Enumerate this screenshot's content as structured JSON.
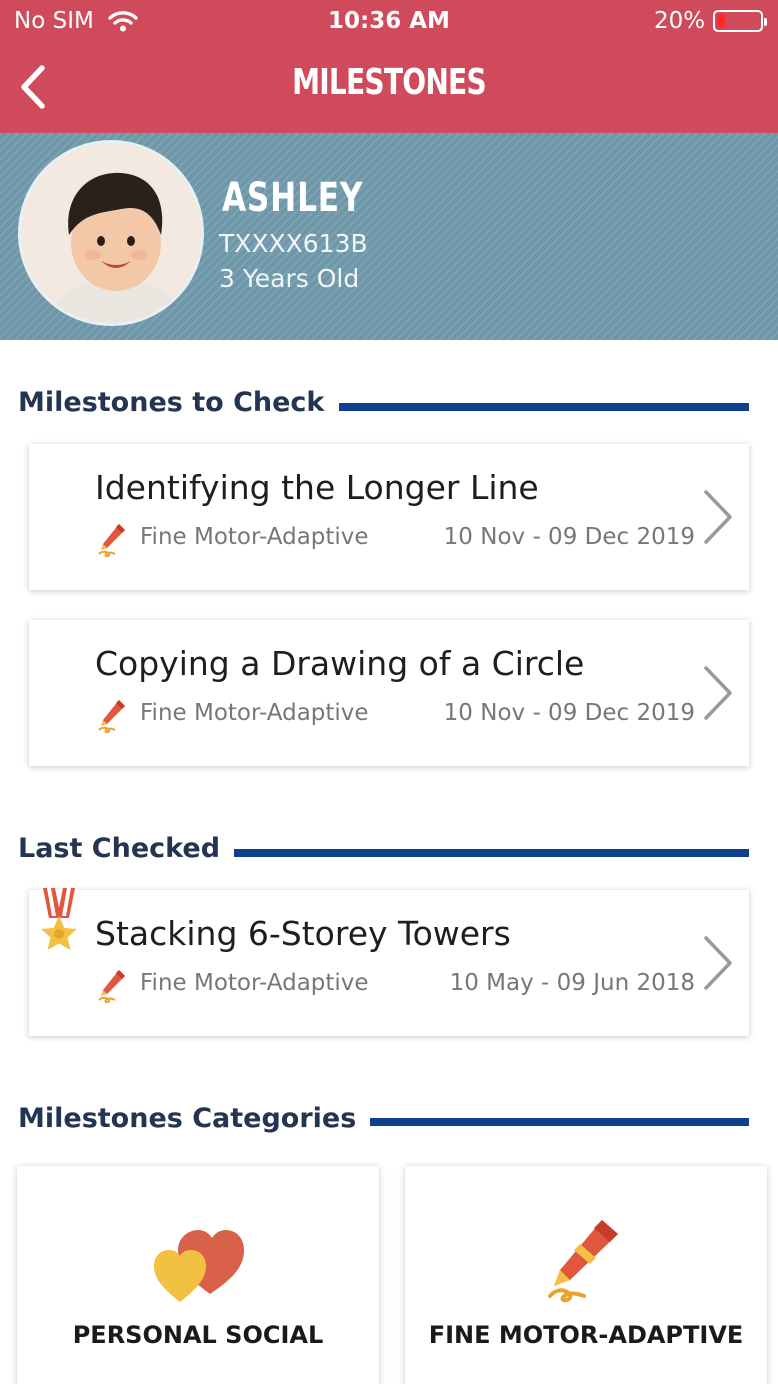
{
  "status_bar": {
    "carrier": "No SIM",
    "time": "10:36 AM",
    "battery": "20%"
  },
  "header": {
    "title": "MILESTONES"
  },
  "profile": {
    "name": "ASHLEY",
    "id": "TXXXX613B",
    "age": "3 Years Old"
  },
  "sections": {
    "to_check": "Milestones to Check",
    "last_checked": "Last Checked",
    "categories": "Milestones Categories"
  },
  "to_check_items": [
    {
      "title": "Identifying the Longer Line",
      "category": "Fine Motor-Adaptive",
      "dates": "10 Nov - 09 Dec 2019"
    },
    {
      "title": "Copying a Drawing of a Circle",
      "category": "Fine Motor-Adaptive",
      "dates": "10 Nov - 09 Dec 2019"
    }
  ],
  "last_checked_item": {
    "title": "Stacking 6-Storey Towers",
    "category": "Fine Motor-Adaptive",
    "dates": "10 May - 09 Jun 2018"
  },
  "categories": [
    {
      "label": "PERSONAL SOCIAL",
      "icon": "hearts-icon"
    },
    {
      "label": "FINE MOTOR-ADAPTIVE",
      "icon": "crayon-icon"
    }
  ],
  "colors": {
    "header": "#cf4a5a",
    "banner": "#6e98a9",
    "accent_line": "#0f3f8f",
    "heading_text": "#243552"
  }
}
